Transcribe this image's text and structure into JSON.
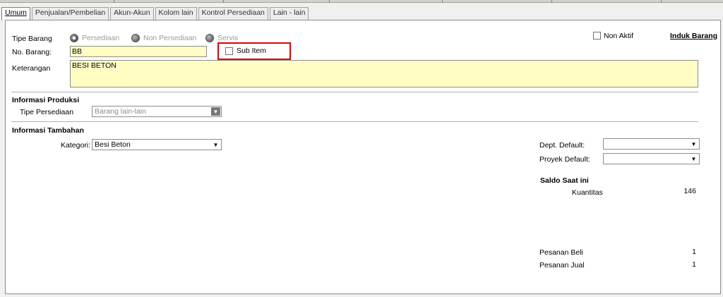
{
  "tabs": [
    {
      "label": "Umum"
    },
    {
      "label": "Penjualan/Pembelian"
    },
    {
      "label": "Akun-Akun"
    },
    {
      "label": "Kolom lain"
    },
    {
      "label": "Kontrol Persediaan"
    },
    {
      "label": "Lain - lain"
    }
  ],
  "form": {
    "tipe_barang_label": "Tipe Barang",
    "radio_persediaan": "Persediaan",
    "radio_non_persediaan": "Non Persediaan",
    "radio_servis": "Servis",
    "non_aktif_label": "Non Aktif",
    "induk_barang_label": "Induk Barang",
    "no_barang_label": "No. Barang:",
    "no_barang_value": "BB",
    "sub_item_label": "Sub Item",
    "keterangan_label": "Keterangan",
    "keterangan_value": "BESI BETON"
  },
  "produksi": {
    "heading": "Informasi Produksi",
    "tipe_persediaan_label": "Tipe Persediaan",
    "tipe_persediaan_value": "Barang lain-lain"
  },
  "tambahan": {
    "heading": "Informasi Tambahan",
    "kategori_label": "Kategori:",
    "kategori_value": "Besi Beton",
    "dept_default_label": "Dept. Default:",
    "dept_default_value": "",
    "proyek_default_label": "Proyek Default:",
    "proyek_default_value": ""
  },
  "saldo": {
    "heading": "Saldo Saat ini",
    "kuantitas_label": "Kuantitas",
    "kuantitas_value": "146",
    "pesanan_beli_label": "Pesanan Beli",
    "pesanan_beli_value": "1",
    "pesanan_jual_label": "Pesanan Jual",
    "pesanan_jual_value": "1"
  },
  "colors": {
    "input_yellow": "#fffdc4",
    "highlight_red": "#e00000"
  },
  "icons": {
    "dropdown": "chevron-down-icon"
  }
}
